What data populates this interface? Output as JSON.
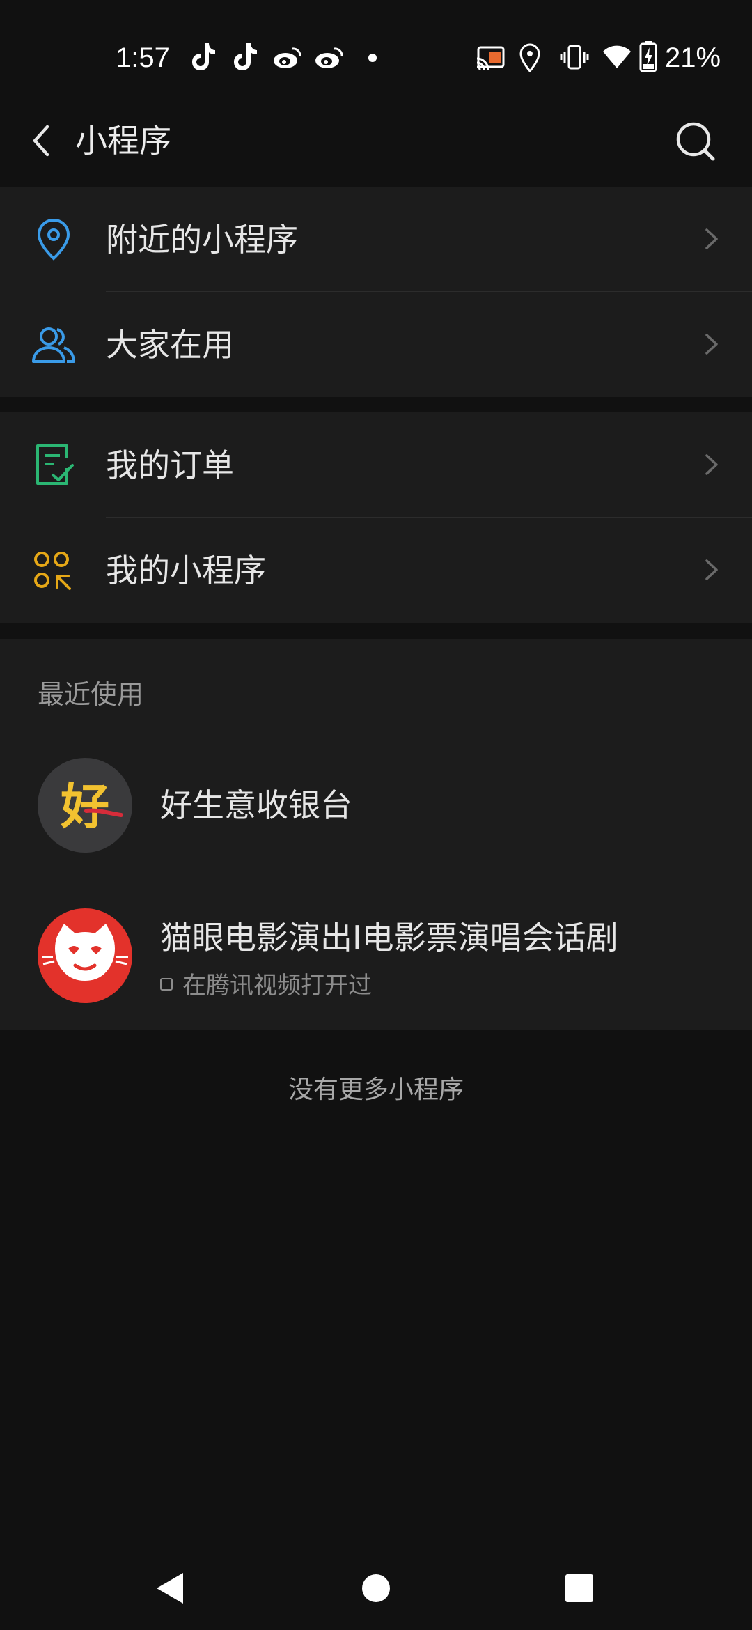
{
  "status_bar": {
    "time": "1:57",
    "battery": "21%",
    "icons": [
      "tiktok-icon",
      "tiktok-icon",
      "weibo-icon",
      "weibo-icon",
      "dot-icon",
      "cast-icon",
      "location-icon",
      "vibrate-icon",
      "wifi-icon",
      "battery-charging-icon"
    ]
  },
  "header": {
    "title": "小程序"
  },
  "menu": {
    "group1": [
      {
        "label": "附近的小程序",
        "icon": "location-pin-icon",
        "color": "#3a9be8"
      },
      {
        "label": "大家在用",
        "icon": "people-icon",
        "color": "#3a9be8"
      }
    ],
    "group2": [
      {
        "label": "我的订单",
        "icon": "order-checklist-icon",
        "color": "#2bb673"
      },
      {
        "label": "我的小程序",
        "icon": "apps-grid-icon",
        "color": "#e6a817"
      }
    ]
  },
  "recent": {
    "header": "最近使用",
    "apps": [
      {
        "name": "好生意收银台",
        "icon": "hao-shengyi-logo",
        "logo_text": "好"
      },
      {
        "name": "猫眼电影演出I电影票演唱会话剧",
        "icon": "maoyan-cat-logo",
        "subtitle": "在腾讯视频打开过"
      }
    ]
  },
  "footer": {
    "no_more": "没有更多小程序"
  },
  "nav": {
    "buttons": [
      "back-triangle-icon",
      "home-circle-icon",
      "recents-square-icon"
    ]
  },
  "colors": {
    "background": "#111111",
    "card": "#1c1c1c",
    "blue_accent": "#3a9be8",
    "green_accent": "#2bb673",
    "yellow_accent": "#e6a817",
    "maoyan_red": "#e3322b"
  }
}
